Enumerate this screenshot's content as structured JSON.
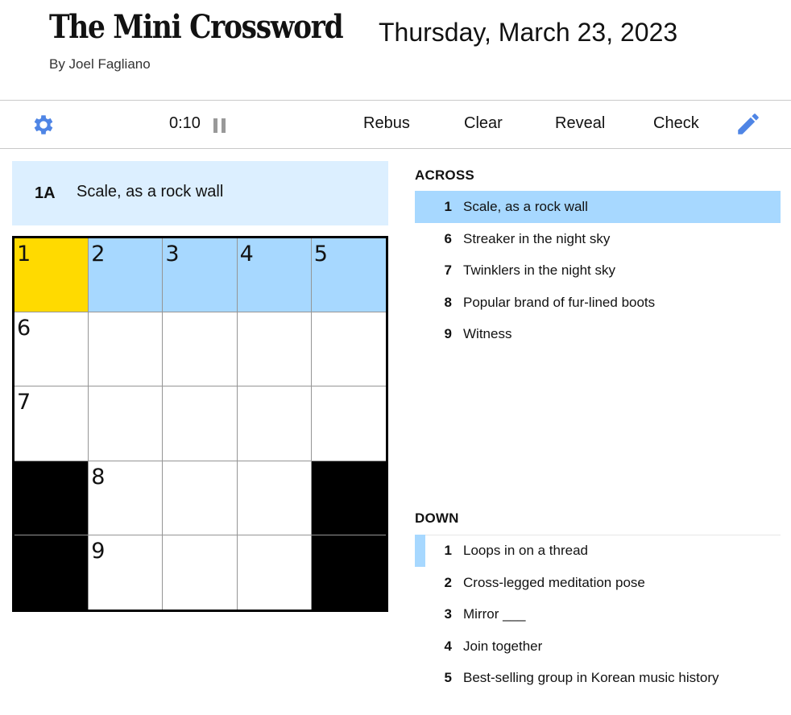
{
  "header": {
    "title": "The Mini Crossword",
    "date": "Thursday, March 23, 2023",
    "byline": "By Joel Fagliano"
  },
  "toolbar": {
    "timer": "0:10",
    "rebus": "Rebus",
    "clear": "Clear",
    "reveal": "Reveal",
    "check": "Check",
    "settings_icon": "gear-icon",
    "pause_icon": "pause-icon",
    "pencil_icon": "pencil-icon"
  },
  "current_clue": {
    "label": "1A",
    "text": "Scale, as a rock wall"
  },
  "colors": {
    "selected_cell": "#ffda00",
    "highlight": "#a7d8ff",
    "clue_bar": "#dcefff",
    "accent_blue": "#4f85e5"
  },
  "grid": {
    "numbers": [
      [
        "1",
        "2",
        "3",
        "4",
        "5"
      ],
      [
        "6",
        "",
        "",
        "",
        ""
      ],
      [
        "7",
        "",
        "",
        "",
        ""
      ],
      [
        "",
        "8",
        "",
        "",
        ""
      ],
      [
        "",
        "9",
        "",
        "",
        ""
      ]
    ],
    "blocks": [
      [
        3,
        0
      ],
      [
        3,
        4
      ],
      [
        4,
        0
      ],
      [
        4,
        4
      ]
    ],
    "selected": [
      0,
      0
    ],
    "highlighted_row": 0
  },
  "across": {
    "heading": "ACROSS",
    "clues": [
      {
        "num": "1",
        "text": "Scale, as a rock wall"
      },
      {
        "num": "6",
        "text": "Streaker in the night sky"
      },
      {
        "num": "7",
        "text": "Twinklers in the night sky"
      },
      {
        "num": "8",
        "text": "Popular brand of fur-lined boots"
      },
      {
        "num": "9",
        "text": "Witness"
      }
    ]
  },
  "down": {
    "heading": "DOWN",
    "clues": [
      {
        "num": "1",
        "text": "Loops in on a thread"
      },
      {
        "num": "2",
        "text": "Cross-legged meditation pose"
      },
      {
        "num": "3",
        "text": "Mirror ___"
      },
      {
        "num": "4",
        "text": "Join together"
      },
      {
        "num": "5",
        "text": "Best-selling group in Korean music history"
      }
    ]
  }
}
